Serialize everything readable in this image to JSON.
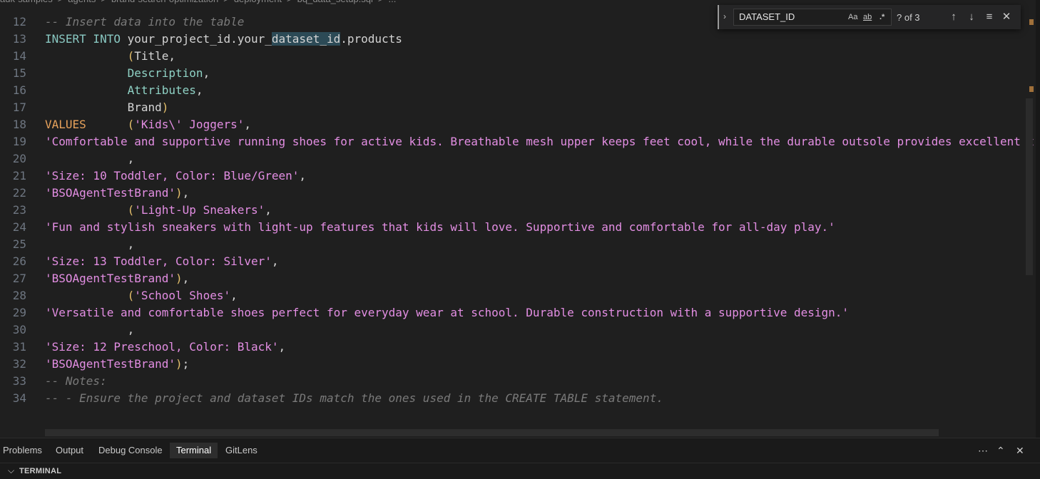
{
  "breadcrumb": [
    "adk-samples",
    "agents",
    "brand-search-optimization",
    "deployment",
    "bq_data_setup.sql",
    "..."
  ],
  "find": {
    "query": "DATASET_ID",
    "match_case_label": "Aa",
    "whole_word_label": "ab",
    "regex_label": ".*",
    "count": "? of 3"
  },
  "lines": [
    {
      "num": "12",
      "tokens": [
        {
          "t": "-- Insert data into the table",
          "c": "comment"
        }
      ]
    },
    {
      "num": "13",
      "tokens": [
        {
          "t": "INSERT INTO ",
          "c": "kw"
        },
        {
          "t": "your_project_id.your_",
          "c": "id"
        },
        {
          "t": "dataset_id",
          "c": "id hl"
        },
        {
          "t": ".products",
          "c": "id"
        }
      ]
    },
    {
      "num": "14",
      "tokens": [
        {
          "t": "            ",
          "c": "id"
        },
        {
          "t": "(",
          "c": "paren"
        },
        {
          "t": "Title,",
          "c": "id"
        }
      ]
    },
    {
      "num": "15",
      "tokens": [
        {
          "t": "            ",
          "c": "id"
        },
        {
          "t": "Description",
          "c": "attr"
        },
        {
          "t": ",",
          "c": "id"
        }
      ]
    },
    {
      "num": "16",
      "tokens": [
        {
          "t": "            ",
          "c": "id"
        },
        {
          "t": "Attributes",
          "c": "attr"
        },
        {
          "t": ",",
          "c": "id"
        }
      ]
    },
    {
      "num": "17",
      "tokens": [
        {
          "t": "            ",
          "c": "id"
        },
        {
          "t": "Brand",
          "c": "id"
        },
        {
          "t": ")",
          "c": "paren"
        }
      ]
    },
    {
      "num": "18",
      "tokens": [
        {
          "t": "VALUES      ",
          "c": "values"
        },
        {
          "t": "(",
          "c": "paren"
        },
        {
          "t": "'Kids\\' Joggers'",
          "c": "str"
        },
        {
          "t": ",",
          "c": "id"
        }
      ]
    },
    {
      "num": "19",
      "tokens": [
        {
          "t": "'Comfortable and supportive running shoes for active kids. Breathable mesh upper keeps feet cool, while the durable outsole provides excellent t",
          "c": "str"
        }
      ]
    },
    {
      "num": "20",
      "tokens": [
        {
          "t": "            ,",
          "c": "id"
        }
      ]
    },
    {
      "num": "21",
      "tokens": [
        {
          "t": "'Size: 10 Toddler, Color: Blue/Green'",
          "c": "str"
        },
        {
          "t": ",",
          "c": "id"
        }
      ]
    },
    {
      "num": "22",
      "tokens": [
        {
          "t": "'BSOAgentTestBrand'",
          "c": "str"
        },
        {
          "t": ")",
          "c": "paren"
        },
        {
          "t": ",",
          "c": "id"
        }
      ]
    },
    {
      "num": "23",
      "tokens": [
        {
          "t": "            ",
          "c": "id"
        },
        {
          "t": "(",
          "c": "paren"
        },
        {
          "t": "'Light-Up Sneakers'",
          "c": "str"
        },
        {
          "t": ",",
          "c": "id"
        }
      ]
    },
    {
      "num": "24",
      "tokens": [
        {
          "t": "'Fun and stylish sneakers with light-up features that kids will love. Supportive and comfortable for all-day play.'",
          "c": "str"
        }
      ]
    },
    {
      "num": "25",
      "tokens": [
        {
          "t": "            ,",
          "c": "id"
        }
      ]
    },
    {
      "num": "26",
      "tokens": [
        {
          "t": "'Size: 13 Toddler, Color: Silver'",
          "c": "str"
        },
        {
          "t": ",",
          "c": "id"
        }
      ]
    },
    {
      "num": "27",
      "tokens": [
        {
          "t": "'BSOAgentTestBrand'",
          "c": "str"
        },
        {
          "t": ")",
          "c": "paren"
        },
        {
          "t": ",",
          "c": "id"
        }
      ]
    },
    {
      "num": "28",
      "tokens": [
        {
          "t": "            ",
          "c": "id"
        },
        {
          "t": "(",
          "c": "paren"
        },
        {
          "t": "'School Shoes'",
          "c": "str"
        },
        {
          "t": ",",
          "c": "id"
        }
      ]
    },
    {
      "num": "29",
      "tokens": [
        {
          "t": "'Versatile and comfortable shoes perfect for everyday wear at school. Durable construction with a supportive design.'",
          "c": "str"
        }
      ]
    },
    {
      "num": "30",
      "tokens": [
        {
          "t": "            ,",
          "c": "id"
        }
      ]
    },
    {
      "num": "31",
      "tokens": [
        {
          "t": "'Size: 12 Preschool, Color: Black'",
          "c": "str"
        },
        {
          "t": ",",
          "c": "id"
        }
      ]
    },
    {
      "num": "32",
      "tokens": [
        {
          "t": "'BSOAgentTestBrand'",
          "c": "str"
        },
        {
          "t": ")",
          "c": "paren"
        },
        {
          "t": ";",
          "c": "id"
        }
      ]
    },
    {
      "num": "33",
      "tokens": [
        {
          "t": "-- Notes:",
          "c": "comment"
        }
      ]
    },
    {
      "num": "34",
      "tokens": [
        {
          "t": "-- - Ensure the project and dataset IDs match the ones used in the CREATE TABLE statement.",
          "c": "comment"
        }
      ]
    }
  ],
  "panel": {
    "tabs": [
      "Problems",
      "Output",
      "Debug Console",
      "Terminal",
      "GitLens"
    ],
    "active_tab": "Terminal",
    "section_title": "TERMINAL"
  },
  "colors": {
    "comment": "#7a7a7a",
    "keyword": "#89c8c2",
    "string": "#e38ee3",
    "paren": "#e5c06b",
    "values_kw": "#e8a25b",
    "match_highlight": "#2c4a56"
  }
}
